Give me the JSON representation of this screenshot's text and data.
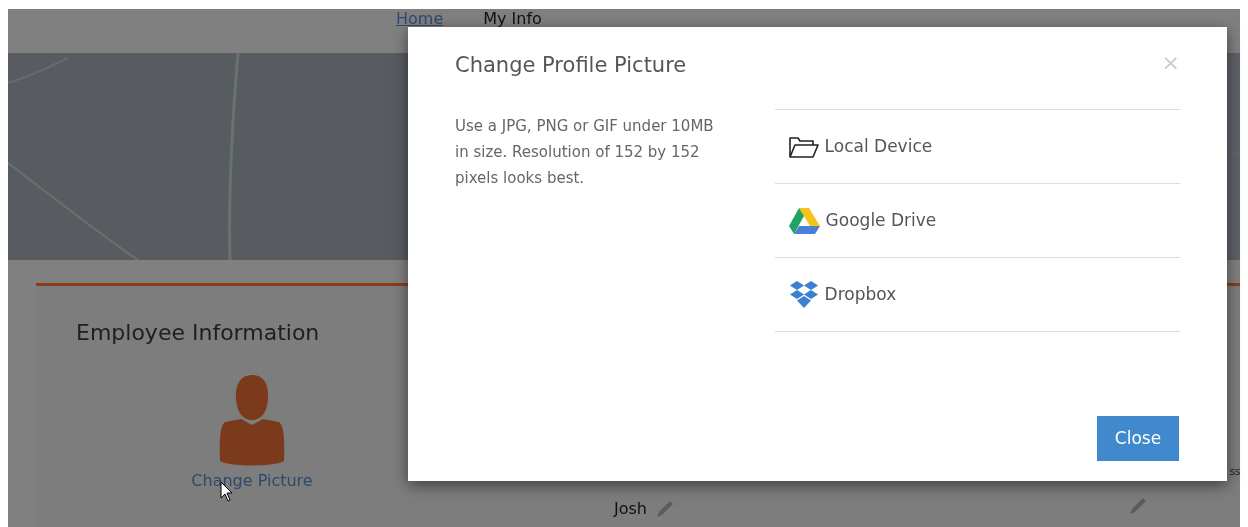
{
  "nav": [
    {
      "label": "Home",
      "selected": true
    },
    {
      "label": "My Info",
      "selected": false
    }
  ],
  "card": {
    "title": "Employee Information",
    "change_picture_link": "Change Picture",
    "first_name_value": "Josh",
    "cut_label": "ss"
  },
  "modal": {
    "title": "Change Profile Picture",
    "close_symbol": "×",
    "description": "Use a JPG, PNG or GIF under 10MB in size. Resolution of 152 by 152 pixels looks best.",
    "sources": [
      {
        "kind": "folder",
        "label": "Local Device"
      },
      {
        "kind": "drive",
        "label": "Google Drive"
      },
      {
        "kind": "dropbox",
        "label": "Dropbox"
      }
    ],
    "close_button": "Close"
  }
}
